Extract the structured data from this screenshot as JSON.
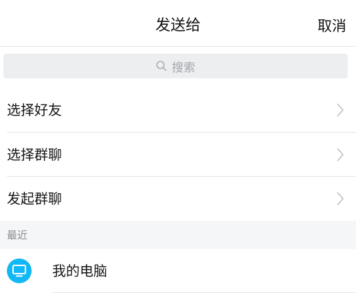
{
  "header": {
    "title": "发送给",
    "cancel_label": "取消"
  },
  "search": {
    "placeholder": "搜索",
    "icon": "search-icon"
  },
  "menu": [
    {
      "label": "选择好友",
      "icon": "chevron-right-icon"
    },
    {
      "label": "选择群聊",
      "icon": "chevron-right-icon"
    },
    {
      "label": "发起群聊",
      "icon": "chevron-right-icon"
    }
  ],
  "recent": {
    "section_label": "最近",
    "items": [
      {
        "name": "我的电脑",
        "icon": "computer-icon",
        "avatar_color": "#12b7f5"
      }
    ]
  }
}
